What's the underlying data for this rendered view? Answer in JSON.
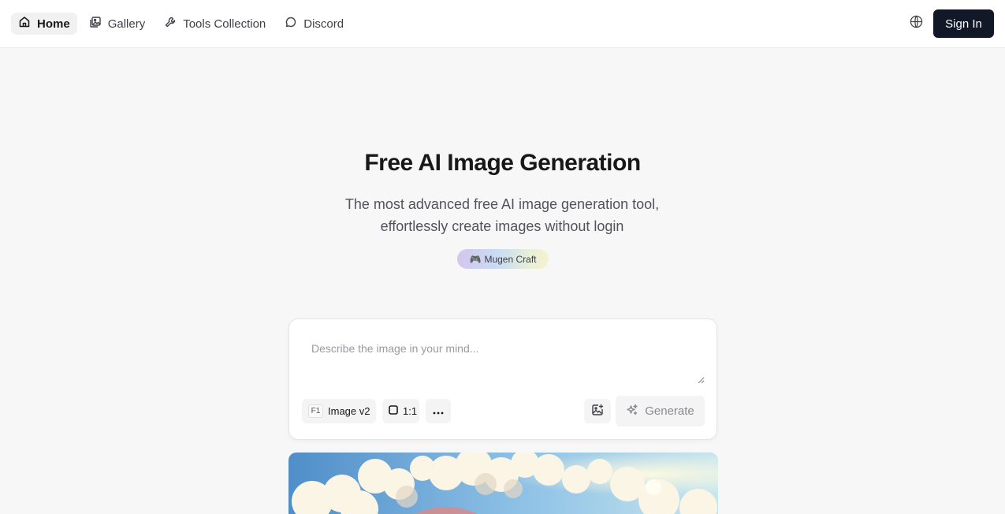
{
  "nav": {
    "items": [
      {
        "label": "Home",
        "icon": "home-icon",
        "active": true
      },
      {
        "label": "Gallery",
        "icon": "gallery-icon",
        "active": false
      },
      {
        "label": "Tools Collection",
        "icon": "wrench-icon",
        "active": false
      },
      {
        "label": "Discord",
        "icon": "chat-bubble-icon",
        "active": false
      }
    ],
    "language_icon": "globe-icon",
    "signin_label": "Sign In"
  },
  "hero": {
    "title": "Free AI Image Generation",
    "subtitle": "The most advanced free AI image generation tool, effortlessly create images without login",
    "badge": {
      "icon": "🎮",
      "label": "Mugen Craft"
    }
  },
  "composer": {
    "placeholder": "Describe the image in your mind...",
    "value": "",
    "model_key": "F1",
    "model_label": "Image v2",
    "ratio_label": "1:1",
    "more_icon": "ellipsis-icon",
    "upload_icon": "image-upload-icon",
    "generate_label": "Generate"
  },
  "colors": {
    "primary_button": "#111827",
    "page_background": "#f7f7f7",
    "badge_gradient": [
      "#d4c6ee",
      "#c9dcf2",
      "#f6f1cf"
    ]
  }
}
